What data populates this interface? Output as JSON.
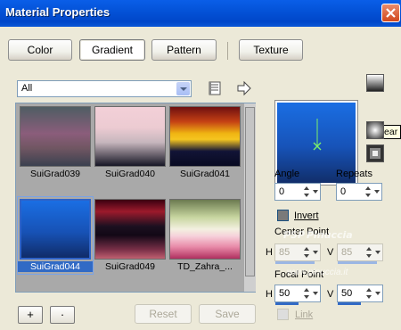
{
  "window": {
    "title": "Material Properties"
  },
  "tabs": [
    {
      "label": "Color"
    },
    {
      "label": "Gradient"
    },
    {
      "label": "Pattern"
    },
    {
      "label": "Texture"
    }
  ],
  "filter": {
    "value": "All"
  },
  "gallery": {
    "items": [
      {
        "label": "SuiGrad039",
        "gradient": "linear-gradient(#4f5d63, #8b5d7b 45%, #705662 70%, #3b4150)"
      },
      {
        "label": "SuiGrad040",
        "gradient": "linear-gradient(#f3d0d8, #eccbd2 35%, #c6b6bd 60%, #161625)"
      },
      {
        "label": "SuiGrad041",
        "gradient": "linear-gradient(#6e1010, #c54114 25%, #f0b512 45%, #f5c520 55%, #121436 75%, #080a22)"
      },
      {
        "label": "SuiGrad044",
        "gradient": "linear-gradient(#1a6ee3, #1752b6 55%, #102c68)"
      },
      {
        "label": "SuiGrad049",
        "gradient": "linear-gradient(#3a0010, #9c1a2c 20%, #1c1020 45%, #120816 60%, #7a3048 85%, #c06070)"
      },
      {
        "label": "TD_Zahra_...",
        "gradient": "linear-gradient(#6b7a50, #c8d6a0 30%, #f3f0e0 50%, #f6d0da 62%, #e88aa8 80%, #b03060)"
      }
    ],
    "selected_index": 3
  },
  "bottom": {
    "add_label": "+",
    "remove_label": "·",
    "reset_label": "Reset",
    "save_label": "Save"
  },
  "right": {
    "tooltip": "Linear",
    "angle_label": "Angle",
    "angle_value": "0",
    "repeats_label": "Repeats",
    "repeats_value": "0",
    "invert_label": "Invert",
    "center_point_label": "Center Point",
    "center_h_label": "H",
    "center_h_value": "85",
    "center_v_label": "V",
    "center_v_value": "85",
    "focal_point_label": "Focal Point",
    "focal_h_label": "H",
    "focal_h_value": "50",
    "focal_v_label": "V",
    "focal_v_value": "50",
    "link_label": "Link"
  },
  "watermark": {
    "logo": "PSP Pinuccia",
    "url": "www.pinuccia.it"
  },
  "colors": {
    "title_bar": "#0453d8",
    "selection": "#316ac5",
    "close_button": "#d2481c"
  }
}
